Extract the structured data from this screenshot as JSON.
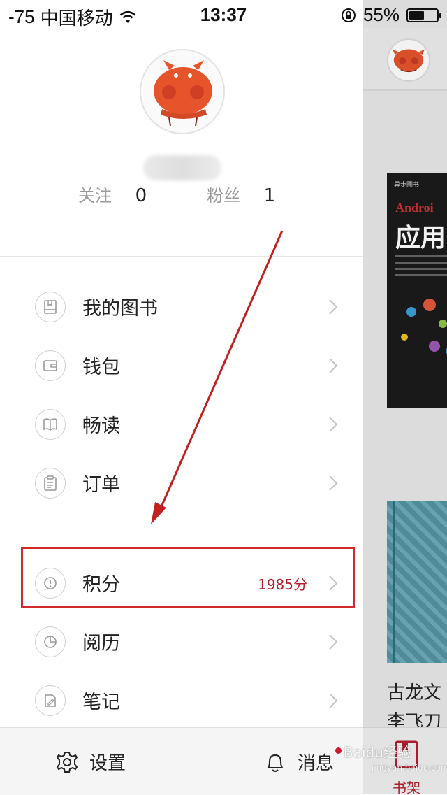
{
  "status_bar": {
    "signal": "-75",
    "carrier": "中国移动",
    "time": "13:37",
    "battery_percent": "55%",
    "battery_level": 0.55
  },
  "profile": {
    "following_label": "关注",
    "following_count": "0",
    "followers_label": "粉丝",
    "followers_count": "1"
  },
  "menu_group1": [
    {
      "label": "我的图书",
      "icon": "book-icon"
    },
    {
      "label": "钱包",
      "icon": "wallet-icon"
    },
    {
      "label": "畅读",
      "icon": "open-book-icon"
    },
    {
      "label": "订单",
      "icon": "clipboard-icon"
    }
  ],
  "menu_group2": [
    {
      "label": "积分",
      "icon": "points-icon",
      "value": "1985分"
    },
    {
      "label": "阅历",
      "icon": "pie-chart-icon"
    },
    {
      "label": "笔记",
      "icon": "note-edit-icon"
    }
  ],
  "bottom_bar": {
    "settings_label": "设置",
    "messages_label": "消息"
  },
  "background_app": {
    "book1_title_en": "Androi",
    "book1_title_cn": "应用",
    "book1_brand": "异步图书",
    "book2_line1": "古龙文",
    "book2_line2": "李飞刀",
    "tab_bookshelf": "书架"
  },
  "watermark": {
    "text": "Baidu经验",
    "sub": "jingyan.baidu.com"
  },
  "colors": {
    "accent": "#b51e2f",
    "highlight_box": "#d12a2a",
    "arrow": "#c21f1f"
  }
}
